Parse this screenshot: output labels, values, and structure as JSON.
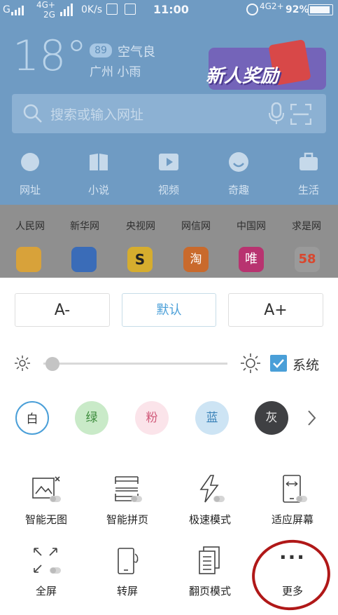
{
  "status_bar": {
    "carrier": "G",
    "net1": "4G+",
    "net2": "2G",
    "speed": "0K/s",
    "time": "11:00",
    "net3": "4G2+",
    "battery": "92%"
  },
  "weather": {
    "temperature": "18°",
    "aqi_value": "89",
    "aqi_label": "空气良",
    "location": "广州 小雨"
  },
  "promo": {
    "text": "新人奖励"
  },
  "search": {
    "placeholder": "搜索或输入网址"
  },
  "nav": [
    {
      "label": "网址",
      "icon": "globe-icon"
    },
    {
      "label": "小说",
      "icon": "book-icon"
    },
    {
      "label": "视频",
      "icon": "play-icon"
    },
    {
      "label": "奇趣",
      "icon": "smile-icon"
    },
    {
      "label": "生活",
      "icon": "briefcase-icon"
    }
  ],
  "site_links": [
    "人民网",
    "新华网",
    "央视网",
    "网信网",
    "中国网",
    "求是网"
  ],
  "app_shortcuts": [
    {
      "icon": "weibo-icon",
      "color": "#f3b53a"
    },
    {
      "icon": "baidu-icon",
      "color": "#3d7ee0"
    },
    {
      "icon": "s-icon",
      "color": "#f2c232",
      "text": "S"
    },
    {
      "icon": "taobao-icon",
      "color": "#f0742c",
      "text": "淘"
    },
    {
      "icon": "vip-icon",
      "color": "#e0367f",
      "text": "唯"
    },
    {
      "icon": "58-icon",
      "color": "#ffffff",
      "text": "58"
    }
  ],
  "font_size": {
    "decrease": "A-",
    "default": "默认",
    "increase": "A+"
  },
  "brightness": {
    "level": 0.05,
    "system_label": "系统",
    "system_checked": true
  },
  "themes": [
    {
      "label": "白",
      "bg": "#ffffff",
      "fg": "#333333",
      "selected": true
    },
    {
      "label": "绿",
      "bg": "#c9eac8",
      "fg": "#3a8a3a"
    },
    {
      "label": "粉",
      "bg": "#fbe4ea",
      "fg": "#d05a7a"
    },
    {
      "label": "蓝",
      "bg": "#cde4f4",
      "fg": "#3a82b8"
    },
    {
      "label": "灰",
      "bg": "#3f4043",
      "fg": "#e8e8e8"
    }
  ],
  "tools": [
    {
      "label": "智能无图",
      "icon": "no-image-icon"
    },
    {
      "label": "智能拼页",
      "icon": "page-join-icon"
    },
    {
      "label": "极速模式",
      "icon": "lightning-icon"
    },
    {
      "label": "适应屏幕",
      "icon": "fit-screen-icon"
    },
    {
      "label": "全屏",
      "icon": "fullscreen-icon"
    },
    {
      "label": "转屏",
      "icon": "rotate-screen-icon"
    },
    {
      "label": "翻页模式",
      "icon": "page-flip-icon"
    },
    {
      "label": "更多",
      "icon": "more-icon",
      "symbol": "···"
    }
  ]
}
